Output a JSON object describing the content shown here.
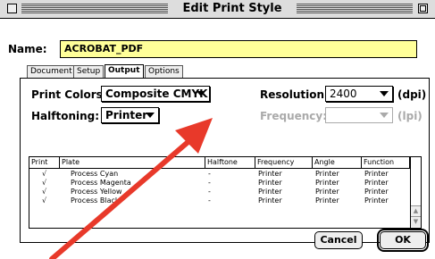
{
  "window": {
    "title": "Edit Print Style"
  },
  "name_field": {
    "label": "Name:",
    "value": "ACROBAT_PDF"
  },
  "tabs": [
    {
      "label": "Document",
      "active": false
    },
    {
      "label": "Setup",
      "active": false
    },
    {
      "label": "Output",
      "active": true
    },
    {
      "label": "Options",
      "active": false
    }
  ],
  "output": {
    "print_colors_label": "Print Colors:",
    "print_colors_value": "Composite CMYK",
    "halftoning_label": "Halftoning:",
    "halftoning_value": "Printer",
    "resolution_label": "Resolution:",
    "resolution_value": "2400",
    "resolution_unit": "(dpi)",
    "frequency_label": "Frequency:",
    "frequency_value": "",
    "frequency_unit": "(lpi)"
  },
  "plates_table": {
    "headers": [
      "Print",
      "Plate",
      "Halftone",
      "Frequency",
      "Angle",
      "Function"
    ],
    "rows": [
      {
        "print": "√",
        "plate": "Process Cyan",
        "halftone": "-",
        "frequency": "Printer",
        "angle": "Printer",
        "function": "Printer"
      },
      {
        "print": "√",
        "plate": "Process Magenta",
        "halftone": "-",
        "frequency": "Printer",
        "angle": "Printer",
        "function": "Printer"
      },
      {
        "print": "√",
        "plate": "Process Yellow",
        "halftone": "-",
        "frequency": "Printer",
        "angle": "Printer",
        "function": "Printer"
      },
      {
        "print": "√",
        "plate": "Process Black",
        "halftone": "-",
        "frequency": "Printer",
        "angle": "Printer",
        "function": "Printer"
      }
    ]
  },
  "buttons": {
    "cancel": "Cancel",
    "ok": "OK"
  },
  "colors": {
    "name_field_bg": "#ffff99",
    "annotation_arrow": "#e8392a",
    "disabled_text": "#aaaaaa"
  },
  "icons": {
    "popup_indicator": "triangle-down-icon",
    "scroll_up": "scroll-up-arrow-icon",
    "scroll_down": "scroll-down-arrow-icon"
  }
}
